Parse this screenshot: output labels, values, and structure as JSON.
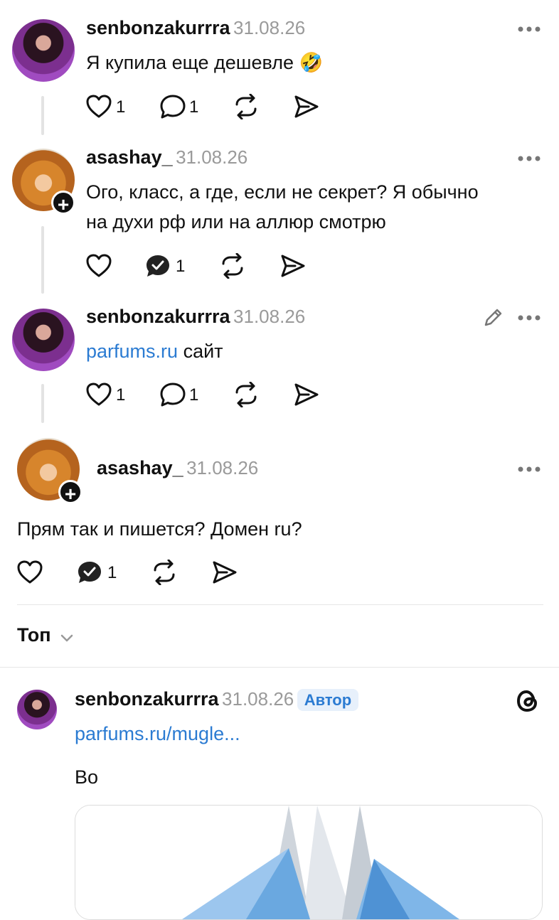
{
  "comments": [
    {
      "username": "senbonzakurrra",
      "date": "31.08.26",
      "text": "Я купила еще дешевле 🤣",
      "like_count": "1",
      "reply_count": "1"
    },
    {
      "username": "asashay_",
      "date": "31.08.26",
      "text_line1": "Ого, класс, а где, если не секрет? Я обычно",
      "text_line2": "на духи рф или на аллюр смотрю",
      "reply_count": "1"
    },
    {
      "username": "senbonzakurrra",
      "date": "31.08.26",
      "link": "parfums.ru",
      "text": "сайт",
      "like_count": "1",
      "reply_count": "1"
    },
    {
      "username": "asashay_",
      "date": "31.08.26",
      "text": "Прям так и пишется? Домен ru?",
      "reply_count": "1"
    }
  ],
  "sort": {
    "label": "Топ"
  },
  "top_post": {
    "username": "senbonzakurrra",
    "date": "31.08.26",
    "badge": "Автор",
    "link": "parfums.ru/mugle...",
    "text": "Во"
  },
  "icons": {
    "like": "heart-icon",
    "reply": "comment-icon",
    "reply_done": "comment-check-icon",
    "repost": "repost-icon",
    "share": "send-icon",
    "more": "more-dots-icon",
    "edit": "pencil-icon",
    "threads": "threads-logo-icon"
  },
  "colors": {
    "link": "#2b7bd2",
    "date": "#9a9a9a",
    "badge_bg": "#e7f0fb"
  }
}
